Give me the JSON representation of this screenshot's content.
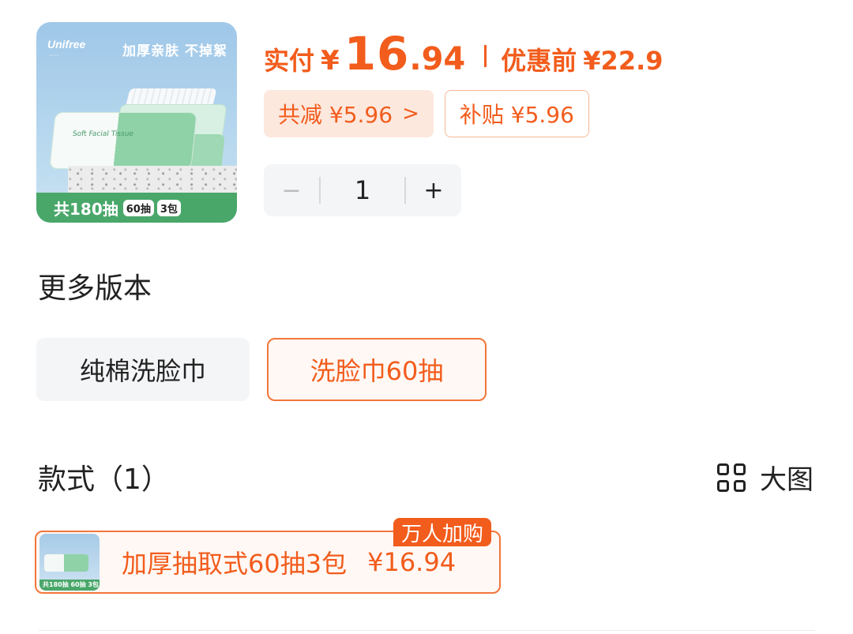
{
  "product": {
    "thumb": {
      "brand": "Unifree",
      "slogan": "加厚亲肤 不掉絮",
      "pack_text": "Soft Facial Tissue",
      "bar_total": "共180抽",
      "chip_count": "60抽",
      "chip_packs": "3包"
    },
    "price": {
      "label": "实付",
      "currency": "¥",
      "integer": "16",
      "decimal": ".94",
      "before_label": "优惠前",
      "before_value": "¥22.9"
    },
    "discounts": {
      "total": "共减 ¥5.96",
      "subsidy": "补贴 ¥5.96"
    },
    "quantity": {
      "value": "1",
      "minus": "−",
      "plus": "+"
    }
  },
  "versions": {
    "title": "更多版本",
    "options": [
      "纯棉洗脸巾",
      "洗脸巾60抽"
    ],
    "selected_index": 1
  },
  "styles": {
    "title": "款式（1）",
    "view_toggle": "大图",
    "items": [
      {
        "name": "加厚抽取式60抽3包",
        "price": "¥16.94",
        "tag": "万人加购",
        "mini_bar": "共180抽 60抽 3包"
      }
    ]
  },
  "colors": {
    "accent": "#f25c1c",
    "accent_bg": "#fde8de",
    "green": "#4aa76a"
  }
}
